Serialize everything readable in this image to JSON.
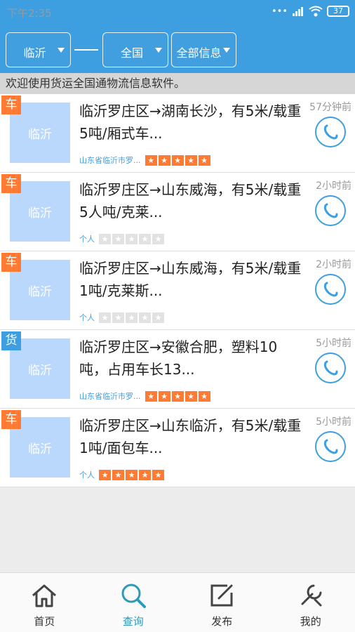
{
  "status": {
    "time": "下午2:35",
    "battery": "37"
  },
  "filters": {
    "from": "临沂",
    "to": "全国",
    "type": "全部信息"
  },
  "notice": "欢迎使用货运全国通物流信息软件。",
  "items": [
    {
      "tag": "车",
      "thumb": "临沂",
      "title": "临沂罗庄区→湖南长沙，有5米/载重5吨/厢式车...",
      "time": "57分钟前",
      "owner": "山东省临沂市罗...",
      "stars": 5
    },
    {
      "tag": "车",
      "thumb": "临沂",
      "title": "临沂罗庄区→山东威海，有5米/载重5人吨/克莱...",
      "time": "2小时前",
      "owner": "个人",
      "stars": 0
    },
    {
      "tag": "车",
      "thumb": "临沂",
      "title": "临沂罗庄区→山东威海，有5米/载重1吨/克莱斯...",
      "time": "2小时前",
      "owner": "个人",
      "stars": 0
    },
    {
      "tag": "货",
      "thumb": "临沂",
      "title": "临沂罗庄区→安徽合肥，塑料10吨，占用车长13...",
      "time": "5小时前",
      "owner": "山东省临沂市罗...",
      "stars": 5
    },
    {
      "tag": "车",
      "thumb": "临沂",
      "title": "临沂罗庄区→山东临沂，有5米/载重1吨/面包车...",
      "time": "5小时前",
      "owner": "个人",
      "stars": 5
    }
  ],
  "tabs": [
    {
      "label": "首页",
      "icon": "home-icon",
      "active": false
    },
    {
      "label": "查询",
      "icon": "search-icon",
      "active": true
    },
    {
      "label": "发布",
      "icon": "edit-icon",
      "active": false
    },
    {
      "label": "我的",
      "icon": "wrench-icon",
      "active": false
    }
  ]
}
